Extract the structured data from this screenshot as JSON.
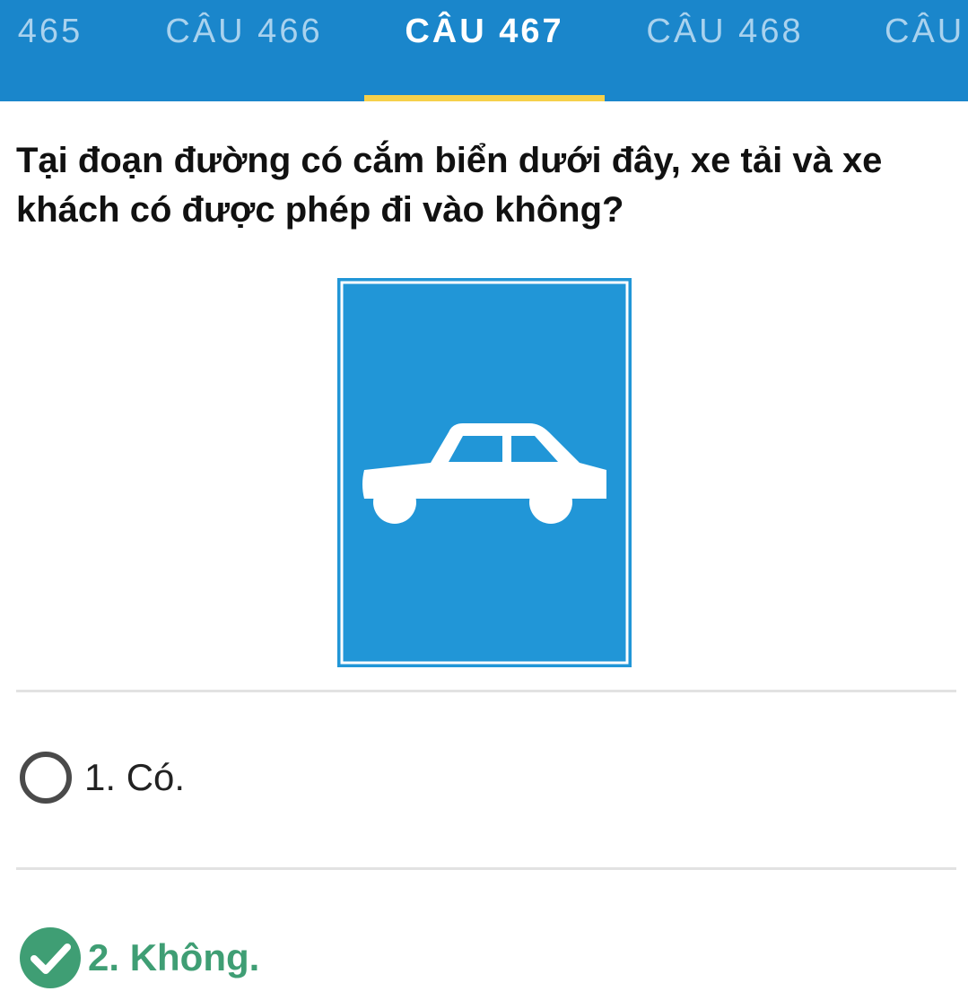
{
  "tabs": [
    {
      "label": "465",
      "active": false
    },
    {
      "label": "CÂU 466",
      "active": false
    },
    {
      "label": "CÂU 467",
      "active": true
    },
    {
      "label": "CÂU 468",
      "active": false
    },
    {
      "label": "CÂU",
      "active": false
    }
  ],
  "question": {
    "text": "Tại đoạn đường có cắm biển dưới đây, xe tải và xe khách có được phép đi vào không?"
  },
  "sign": {
    "icon": "car-icon",
    "background_color": "#2196d7"
  },
  "options": [
    {
      "label": "1. Có.",
      "selected": false,
      "correct": false
    },
    {
      "label": "2. Không.",
      "selected": true,
      "correct": true
    }
  ],
  "colors": {
    "header": "#1a86cb",
    "tab_indicator": "#f6d04a",
    "correct": "#3f9e74"
  }
}
